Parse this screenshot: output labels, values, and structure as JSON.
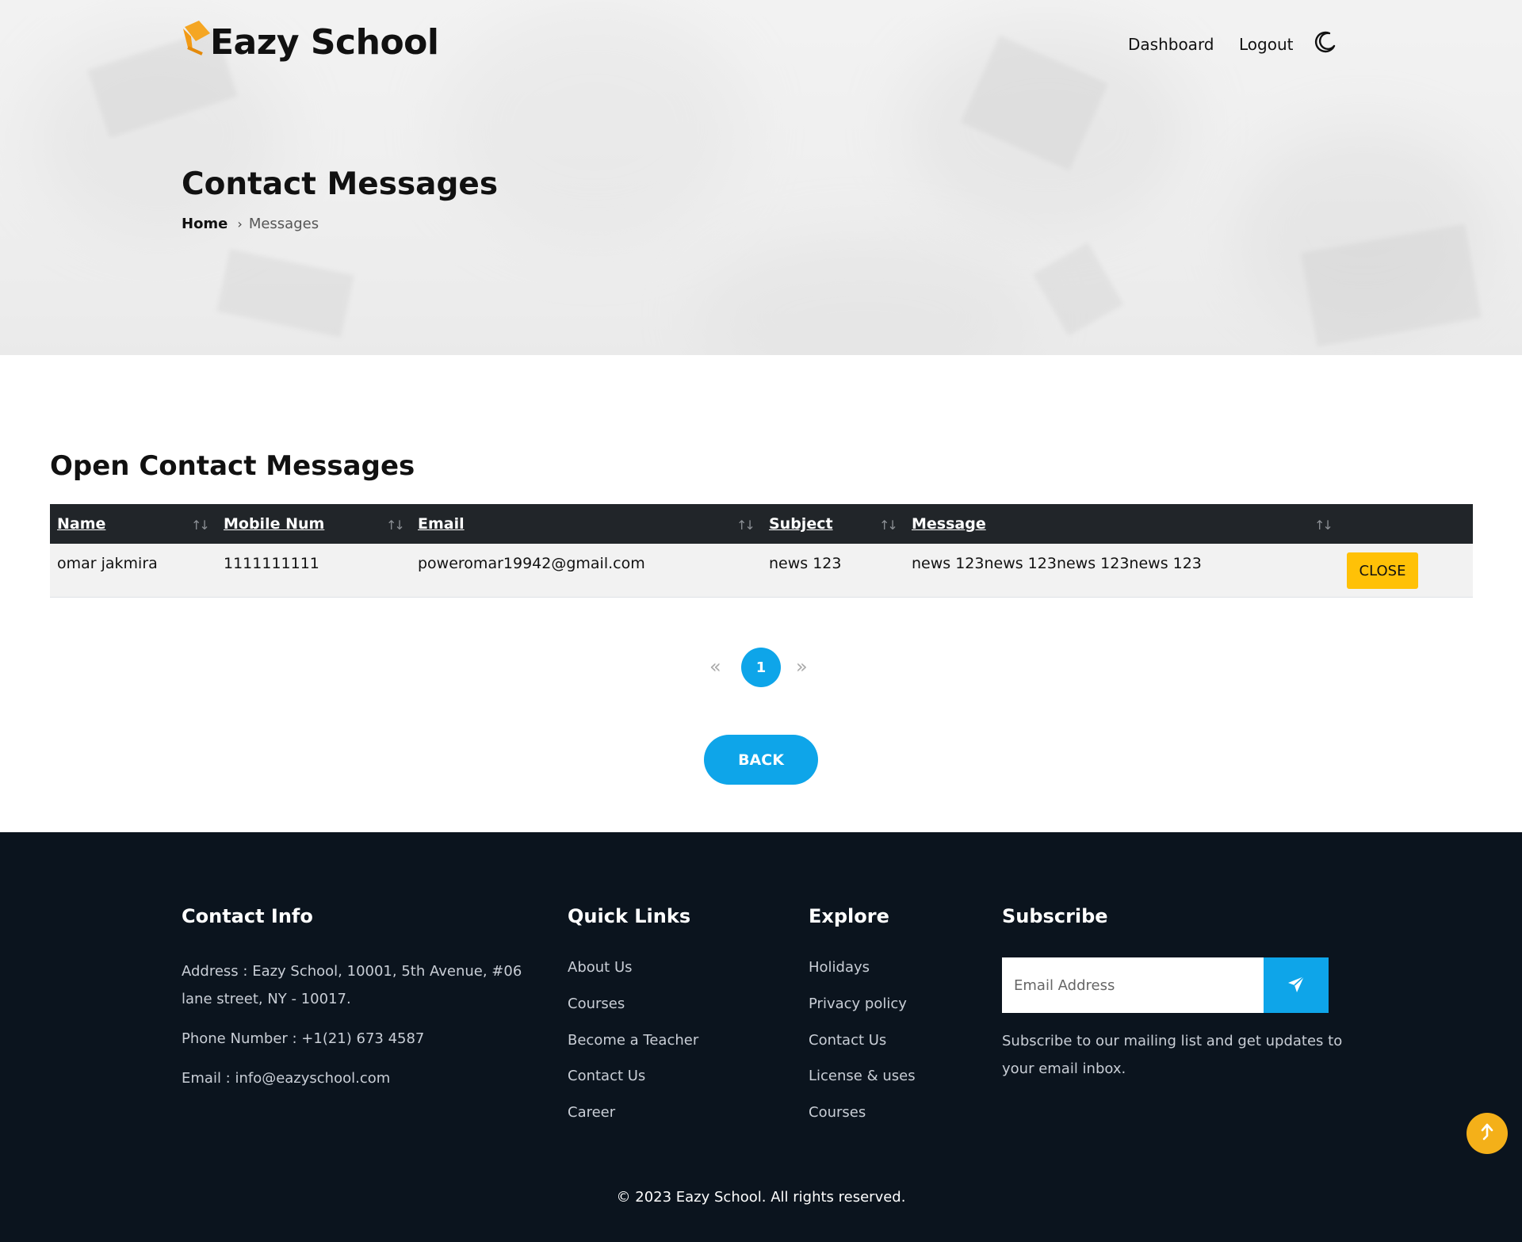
{
  "header": {
    "logo_text": "Eazy School",
    "nav": {
      "dashboard": "Dashboard",
      "logout": "Logout"
    },
    "theme_toggle_icon": "moon-icon"
  },
  "hero": {
    "title": "Contact Messages",
    "breadcrumb": {
      "home": "Home",
      "current": "Messages"
    }
  },
  "main": {
    "section_title": "Open Contact Messages",
    "table": {
      "columns": [
        "Name",
        "Mobile Num",
        "Email",
        "Subject",
        "Message"
      ],
      "rows": [
        {
          "name": "omar jakmira",
          "mobile": "1111111111",
          "email": "poweromar19942@gmail.com",
          "subject": "news 123",
          "message": "news 123news 123news 123news 123",
          "action": "CLOSE"
        }
      ]
    },
    "pagination": {
      "prev": "«",
      "current": "1",
      "next": "»"
    },
    "back_label": "BACK"
  },
  "footer": {
    "contact": {
      "title": "Contact Info",
      "address_line1": "Address : Eazy School, 10001, 5th Avenue, #06",
      "address_line2": "lane street, NY - 10017.",
      "phone": "Phone Number : +1(21) 673 4587",
      "email": "Email : info@eazyschool.com"
    },
    "quick_links": {
      "title": "Quick Links",
      "items": [
        "About Us",
        "Courses",
        "Become a Teacher",
        "Contact Us",
        "Career"
      ]
    },
    "explore": {
      "title": "Explore",
      "items": [
        "Holidays",
        "Privacy policy",
        "Contact Us",
        "License & uses",
        "Courses"
      ]
    },
    "subscribe": {
      "title": "Subscribe",
      "placeholder": "Email Address",
      "text_line1": "Subscribe to our mailing list and get updates to",
      "text_line2": "your email inbox."
    },
    "copyright": "© 2023 Eazy School. All rights reserved."
  },
  "colors": {
    "accent_blue": "#0ea5e9",
    "close_yellow": "#ffc107",
    "scroll_top_orange": "#f4b019",
    "footer_bg": "#0b141e",
    "table_header_bg": "#212529"
  }
}
